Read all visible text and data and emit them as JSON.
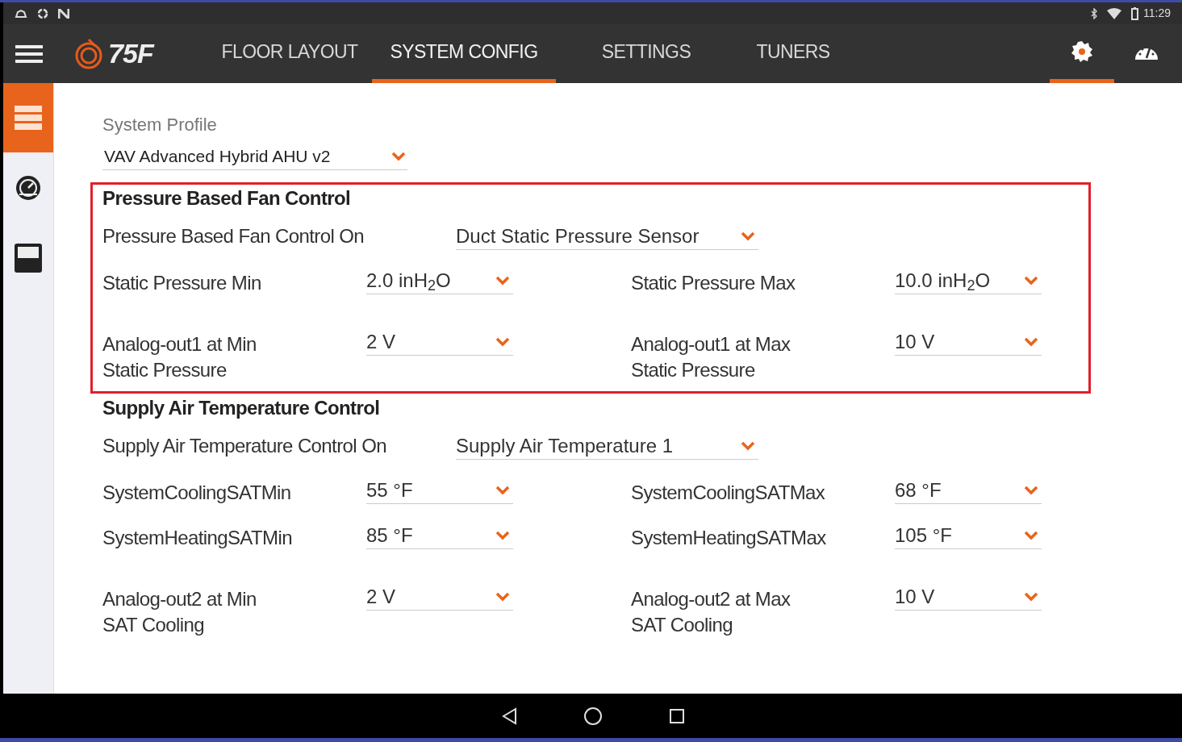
{
  "status_bar": {
    "time": "11:29"
  },
  "app_bar": {
    "logo": "75F",
    "tabs": [
      {
        "label": "FLOOR LAYOUT",
        "selected": false
      },
      {
        "label": "SYSTEM CONFIG",
        "selected": true
      },
      {
        "label": "SETTINGS",
        "selected": false
      },
      {
        "label": "TUNERS",
        "selected": false
      }
    ],
    "icon_tabs": [
      {
        "kind": "settings",
        "selected": true
      },
      {
        "kind": "dashboard",
        "selected": false
      }
    ]
  },
  "sidebar": {
    "items": [
      {
        "kind": "list",
        "selected": true
      },
      {
        "kind": "gauge",
        "selected": false
      },
      {
        "kind": "meter",
        "selected": false
      }
    ]
  },
  "system_profile": {
    "label": "System Profile",
    "value": "VAV Advanced Hybrid AHU v2"
  },
  "sections": [
    {
      "title": "Pressure Based Fan Control",
      "highlighted": true,
      "control_on": {
        "label": "Pressure Based Fan Control On",
        "value": "Duct Static Pressure Sensor"
      },
      "rows": [
        [
          {
            "label": "Static Pressure Min",
            "value": "2.0 inH$_{2}$O"
          },
          {
            "label": "Static Pressure Max",
            "value": "10.0 inH$_{2}$O"
          }
        ],
        [
          {
            "label": "Analog-out1 at Min\nStatic Pressure",
            "value": "2 V"
          },
          {
            "label": "Analog-out1 at Max\nStatic Pressure",
            "value": "10 V"
          }
        ]
      ]
    },
    {
      "title": "Supply Air Temperature Control",
      "highlighted": false,
      "control_on": {
        "label": "Supply Air Temperature Control On",
        "value": "Supply Air Temperature 1"
      },
      "rows": [
        [
          {
            "label": "SystemCoolingSATMin",
            "value": "55 °F"
          },
          {
            "label": "SystemCoolingSATMax",
            "value": "68 °F"
          }
        ],
        [
          {
            "label": "SystemHeatingSATMin",
            "value": "85 °F"
          },
          {
            "label": "SystemHeatingSATMax",
            "value": "105 °F"
          }
        ],
        [
          {
            "label": "Analog-out2 at Min\nSAT Cooling",
            "value": "2 V"
          },
          {
            "label": "Analog-out2 at Max\nSAT Cooling",
            "value": "10 V"
          }
        ]
      ]
    }
  ]
}
